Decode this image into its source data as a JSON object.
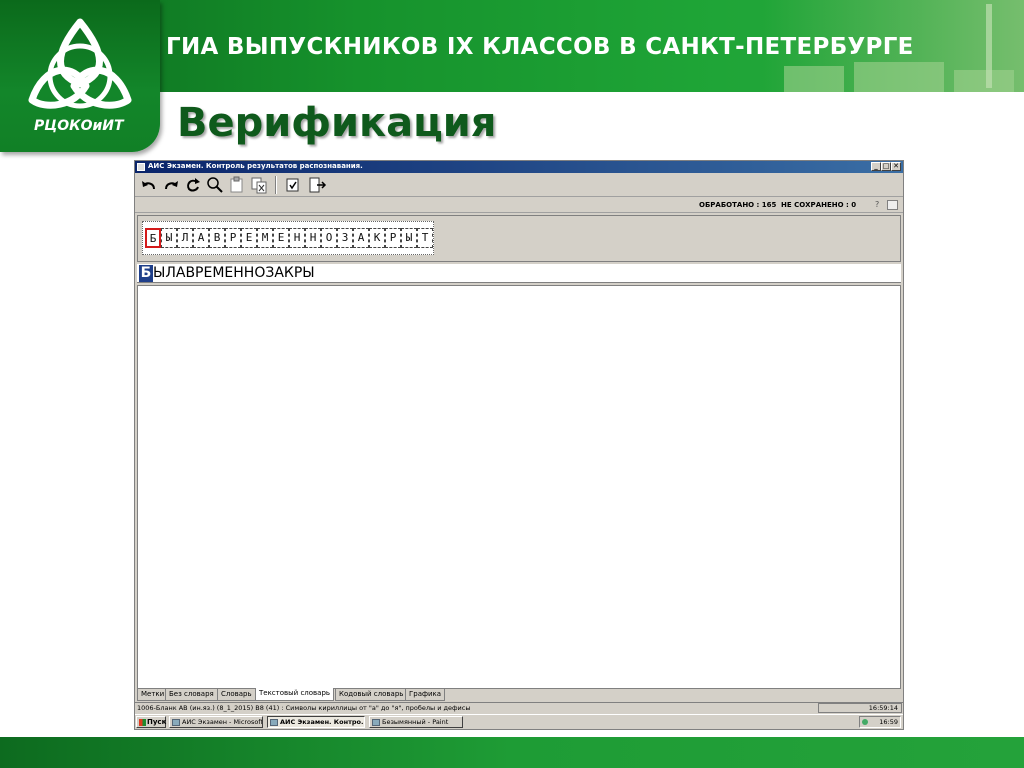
{
  "slide": {
    "banner_title": "ГИА ВЫПУСКНИКОВ IX КЛАССОВ В САНКТ-ПЕТЕРБУРГЕ",
    "logo_text": "РЦОКОиИТ",
    "heading": "Верификация",
    "colors": {
      "banner": "#16922c",
      "heading": "#0f5a1c"
    }
  },
  "window": {
    "title": "АИС Экзамен. Контроль результатов распознавания.",
    "controls": [
      "_",
      "□",
      "✕"
    ],
    "toolbar": [
      {
        "icon": "undo-icon"
      },
      {
        "icon": "redo-icon"
      },
      {
        "icon": "rotate-icon"
      },
      {
        "icon": "search-icon"
      },
      {
        "icon": "paste-icon"
      },
      {
        "icon": "copy-delete-icon"
      },
      {
        "icon": "check-doc-icon"
      },
      {
        "icon": "exit-icon"
      }
    ],
    "status": {
      "processed_label": "ОБРАБОТАНО : 165",
      "unsaved_label": "НЕ СОХРАНЕНО : 0",
      "help": "?"
    },
    "image_chars": [
      "Б",
      "Ы",
      "Л",
      "А",
      "В",
      "Р",
      "Е",
      "М",
      "Е",
      "Н",
      "Н",
      "О",
      "З",
      "А",
      "К",
      "Р",
      "Ы",
      "Т"
    ],
    "recognized": {
      "first": "Б",
      "rest": "ЫЛАВРЕМЕННОЗАКРЫ"
    },
    "tabs": [
      "Метки",
      "Без словаря",
      "Словарь",
      "Текстовый словарь",
      "Кодовый словарь",
      "Графика"
    ],
    "active_tab": 3,
    "info_line": "1006-Бланк АВ (ин.яз.) (8_1_2015)   В8 (41) : Символы кириллицы от \"а\" до \"я\", пробелы и дефисы",
    "info_time": "16:59:14",
    "taskbar": {
      "start": "Пуск",
      "tasks": [
        "АИС Экзамен - Microsoft...",
        "АИС Экзамен. Контро...",
        "Безымянный - Paint"
      ],
      "active_task": 1,
      "clock": "16:59"
    }
  }
}
